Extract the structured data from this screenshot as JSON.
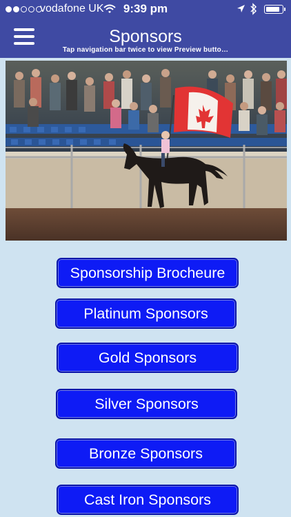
{
  "status_bar": {
    "carrier": "vodafone UK",
    "time": "9:39 pm",
    "signal_bars_filled": 2,
    "signal_bars_total": 5,
    "battery_level": 0.9,
    "icons": [
      "wifi-icon",
      "location-icon",
      "bluetooth-icon",
      "battery-icon"
    ]
  },
  "nav": {
    "title": "Sponsors",
    "subtitle": "Tap navigation bar twice to view Preview butto…",
    "menu_icon": "hamburger-menu-icon",
    "bar_color": "#3f4aa3"
  },
  "hero": {
    "icon": "rodeo-flag-rider-photo"
  },
  "buttons": [
    {
      "label": "Sponsorship Brocheure"
    },
    {
      "label": "Platinum Sponsors"
    },
    {
      "label": "Gold Sponsors"
    },
    {
      "label": "Silver Sponsors"
    },
    {
      "label": "Bronze Sponsors"
    },
    {
      "label": "Cast Iron Sponsors"
    }
  ],
  "colors": {
    "background": "#cfe3f1",
    "button_fill": "#0e1bf5",
    "button_border": "#0a14a8"
  }
}
